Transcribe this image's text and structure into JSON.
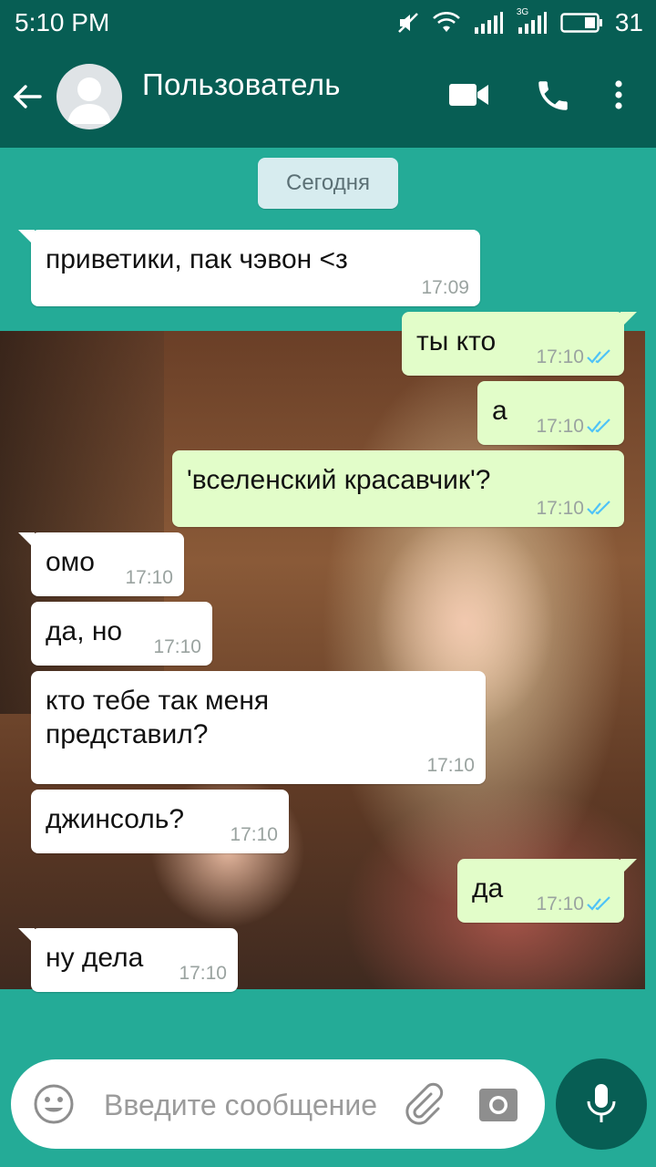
{
  "status_bar": {
    "time": "5:10 PM",
    "network_label": "3G",
    "battery": "31",
    "icons": [
      "mute-icon",
      "wifi-icon",
      "signal-icon",
      "signal-3g-icon",
      "battery-icon"
    ]
  },
  "header": {
    "contact_name": "Пользователь",
    "icons": [
      "back-arrow-icon",
      "avatar",
      "video-call-icon",
      "phone-icon",
      "more-vert-icon"
    ]
  },
  "chat": {
    "date_chip": "Сегодня",
    "messages": [
      {
        "direction": "in",
        "text": "приветики, пак чэвон <з",
        "time": "17:09"
      },
      {
        "direction": "out",
        "text": "ты кто",
        "time": "17:10",
        "read": true
      },
      {
        "direction": "out",
        "text": "а",
        "time": "17:10",
        "read": true
      },
      {
        "direction": "out",
        "text": "'вселенский красавчик'?",
        "time": "17:10",
        "read": true
      },
      {
        "direction": "in",
        "text": "омо",
        "time": "17:10"
      },
      {
        "direction": "in",
        "text": "да, но",
        "time": "17:10"
      },
      {
        "direction": "in",
        "lines": [
          "кто тебе так меня",
          "представил?"
        ],
        "time": "17:10"
      },
      {
        "direction": "in",
        "text": "джинсоль?",
        "time": "17:10"
      },
      {
        "direction": "out",
        "text": "да",
        "time": "17:10",
        "read": true
      },
      {
        "direction": "in",
        "text": "ну дела",
        "time": "17:10"
      }
    ]
  },
  "composer": {
    "placeholder": "Введите сообщение",
    "icons": [
      "emoji-icon",
      "attach-icon",
      "camera-icon",
      "mic-icon"
    ]
  },
  "colors": {
    "header_bg": "#075e54",
    "chat_bg": "#24ab97",
    "incoming_bubble": "#ffffff",
    "outgoing_bubble": "#e2fdc9",
    "read_ticks": "#4fc3f7"
  }
}
